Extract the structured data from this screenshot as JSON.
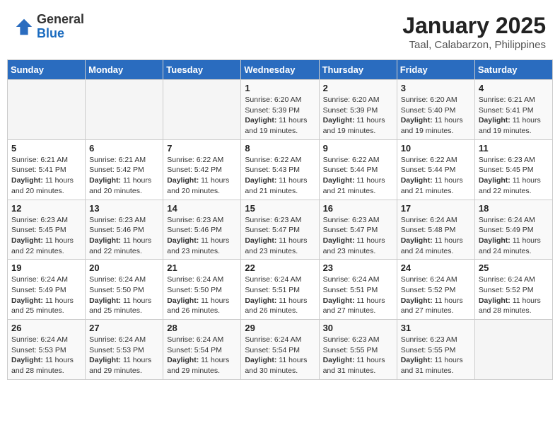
{
  "header": {
    "logo_general": "General",
    "logo_blue": "Blue",
    "title": "January 2025",
    "subtitle": "Taal, Calabarzon, Philippines"
  },
  "weekdays": [
    "Sunday",
    "Monday",
    "Tuesday",
    "Wednesday",
    "Thursday",
    "Friday",
    "Saturday"
  ],
  "weeks": [
    [
      {
        "day": "",
        "info": ""
      },
      {
        "day": "",
        "info": ""
      },
      {
        "day": "",
        "info": ""
      },
      {
        "day": "1",
        "info": "Sunrise: 6:20 AM\nSunset: 5:39 PM\nDaylight: 11 hours and 19 minutes."
      },
      {
        "day": "2",
        "info": "Sunrise: 6:20 AM\nSunset: 5:39 PM\nDaylight: 11 hours and 19 minutes."
      },
      {
        "day": "3",
        "info": "Sunrise: 6:20 AM\nSunset: 5:40 PM\nDaylight: 11 hours and 19 minutes."
      },
      {
        "day": "4",
        "info": "Sunrise: 6:21 AM\nSunset: 5:41 PM\nDaylight: 11 hours and 19 minutes."
      }
    ],
    [
      {
        "day": "5",
        "info": "Sunrise: 6:21 AM\nSunset: 5:41 PM\nDaylight: 11 hours and 20 minutes."
      },
      {
        "day": "6",
        "info": "Sunrise: 6:21 AM\nSunset: 5:42 PM\nDaylight: 11 hours and 20 minutes."
      },
      {
        "day": "7",
        "info": "Sunrise: 6:22 AM\nSunset: 5:42 PM\nDaylight: 11 hours and 20 minutes."
      },
      {
        "day": "8",
        "info": "Sunrise: 6:22 AM\nSunset: 5:43 PM\nDaylight: 11 hours and 21 minutes."
      },
      {
        "day": "9",
        "info": "Sunrise: 6:22 AM\nSunset: 5:44 PM\nDaylight: 11 hours and 21 minutes."
      },
      {
        "day": "10",
        "info": "Sunrise: 6:22 AM\nSunset: 5:44 PM\nDaylight: 11 hours and 21 minutes."
      },
      {
        "day": "11",
        "info": "Sunrise: 6:23 AM\nSunset: 5:45 PM\nDaylight: 11 hours and 22 minutes."
      }
    ],
    [
      {
        "day": "12",
        "info": "Sunrise: 6:23 AM\nSunset: 5:45 PM\nDaylight: 11 hours and 22 minutes."
      },
      {
        "day": "13",
        "info": "Sunrise: 6:23 AM\nSunset: 5:46 PM\nDaylight: 11 hours and 22 minutes."
      },
      {
        "day": "14",
        "info": "Sunrise: 6:23 AM\nSunset: 5:46 PM\nDaylight: 11 hours and 23 minutes."
      },
      {
        "day": "15",
        "info": "Sunrise: 6:23 AM\nSunset: 5:47 PM\nDaylight: 11 hours and 23 minutes."
      },
      {
        "day": "16",
        "info": "Sunrise: 6:23 AM\nSunset: 5:47 PM\nDaylight: 11 hours and 23 minutes."
      },
      {
        "day": "17",
        "info": "Sunrise: 6:24 AM\nSunset: 5:48 PM\nDaylight: 11 hours and 24 minutes."
      },
      {
        "day": "18",
        "info": "Sunrise: 6:24 AM\nSunset: 5:49 PM\nDaylight: 11 hours and 24 minutes."
      }
    ],
    [
      {
        "day": "19",
        "info": "Sunrise: 6:24 AM\nSunset: 5:49 PM\nDaylight: 11 hours and 25 minutes."
      },
      {
        "day": "20",
        "info": "Sunrise: 6:24 AM\nSunset: 5:50 PM\nDaylight: 11 hours and 25 minutes."
      },
      {
        "day": "21",
        "info": "Sunrise: 6:24 AM\nSunset: 5:50 PM\nDaylight: 11 hours and 26 minutes."
      },
      {
        "day": "22",
        "info": "Sunrise: 6:24 AM\nSunset: 5:51 PM\nDaylight: 11 hours and 26 minutes."
      },
      {
        "day": "23",
        "info": "Sunrise: 6:24 AM\nSunset: 5:51 PM\nDaylight: 11 hours and 27 minutes."
      },
      {
        "day": "24",
        "info": "Sunrise: 6:24 AM\nSunset: 5:52 PM\nDaylight: 11 hours and 27 minutes."
      },
      {
        "day": "25",
        "info": "Sunrise: 6:24 AM\nSunset: 5:52 PM\nDaylight: 11 hours and 28 minutes."
      }
    ],
    [
      {
        "day": "26",
        "info": "Sunrise: 6:24 AM\nSunset: 5:53 PM\nDaylight: 11 hours and 28 minutes."
      },
      {
        "day": "27",
        "info": "Sunrise: 6:24 AM\nSunset: 5:53 PM\nDaylight: 11 hours and 29 minutes."
      },
      {
        "day": "28",
        "info": "Sunrise: 6:24 AM\nSunset: 5:54 PM\nDaylight: 11 hours and 29 minutes."
      },
      {
        "day": "29",
        "info": "Sunrise: 6:24 AM\nSunset: 5:54 PM\nDaylight: 11 hours and 30 minutes."
      },
      {
        "day": "30",
        "info": "Sunrise: 6:23 AM\nSunset: 5:55 PM\nDaylight: 11 hours and 31 minutes."
      },
      {
        "day": "31",
        "info": "Sunrise: 6:23 AM\nSunset: 5:55 PM\nDaylight: 11 hours and 31 minutes."
      },
      {
        "day": "",
        "info": ""
      }
    ]
  ]
}
